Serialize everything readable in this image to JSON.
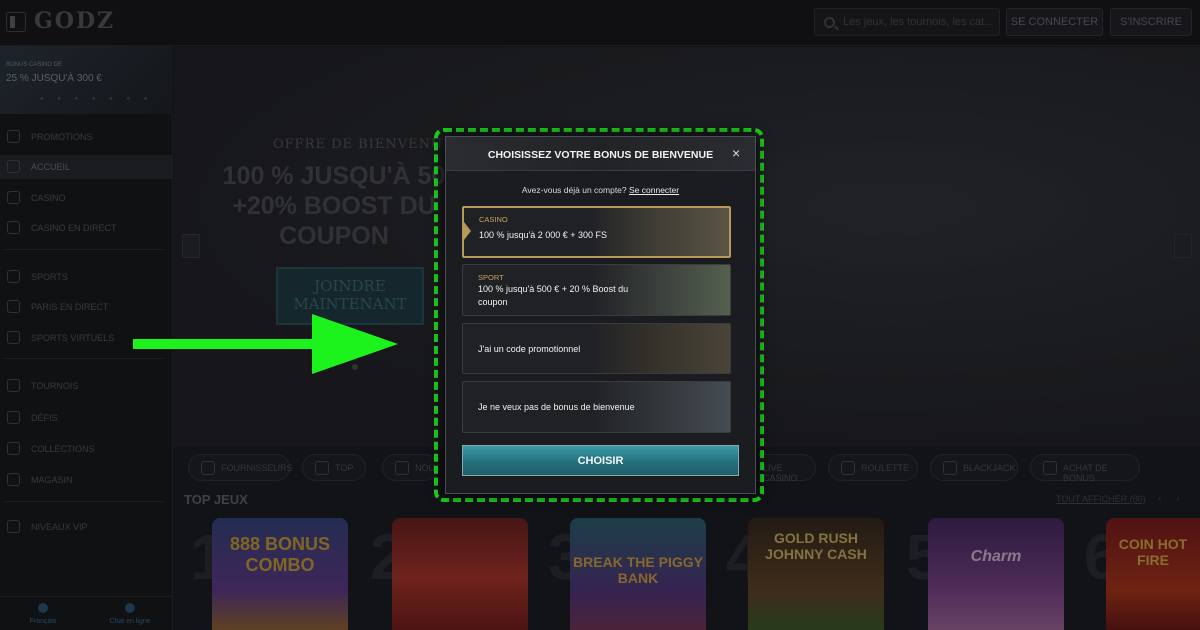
{
  "header": {
    "logo": "GODZ",
    "search_placeholder": "Les jeux, les tournois, les cat...",
    "login_label": "SE CONNECTER",
    "signup_label": "S'INSCRIRE"
  },
  "sidebar": {
    "promo": {
      "small": "BONUS CASINO DE",
      "big": "25 % JUSQU'À 300 €"
    },
    "items": [
      {
        "label": "PROMOTIONS",
        "icon": "gift-icon"
      },
      {
        "label": "ACCUEIL",
        "icon": "home-icon"
      },
      {
        "label": "CASINO",
        "icon": "slot-icon"
      },
      {
        "label": "CASINO EN DIRECT",
        "icon": "live-icon"
      },
      {
        "label": "SPORTS",
        "icon": "ball-icon"
      },
      {
        "label": "PARIS EN DIRECT",
        "icon": "live-bet-icon"
      },
      {
        "label": "SPORTS VIRTUELS",
        "icon": "virtual-icon"
      },
      {
        "label": "TOURNOIS",
        "icon": "trophy-icon"
      },
      {
        "label": "DÉFIS",
        "icon": "target-icon"
      },
      {
        "label": "COLLECTIONS",
        "icon": "collection-icon"
      },
      {
        "label": "MAGASIN",
        "icon": "shop-icon"
      },
      {
        "label": "NIVEAUX VIP",
        "icon": "vip-icon"
      }
    ],
    "bottom": {
      "left": "Français",
      "right": "Chat en ligne"
    }
  },
  "hero": {
    "kicker": "OFFRE DE BIENVENUE SPORT",
    "title": "100 % JUSQU'À 50 +20% BOOST DU COUPON",
    "cta": "JOINDRE MAINTENANT"
  },
  "chips": [
    "FOURNISSEURS",
    "TOP",
    "NOU",
    "LIVE CASINO",
    "ROULETTE",
    "BLACKJACK",
    "ACHAT DE BONUS"
  ],
  "top_games": {
    "title": "TOP JEUX",
    "view_all": "TOUT AFFICHER (80)",
    "arrows": "‹ ›",
    "ranks": [
      "1",
      "2",
      "3",
      "4",
      "5",
      "6"
    ],
    "cards": [
      "888 BONUS COMBO",
      "",
      "BREAK THE PIGGY BANK",
      "GOLD RUSH JOHNNY CASH",
      "Charm",
      "COIN HOT FIRE"
    ]
  },
  "modal": {
    "title": "CHOISISSEZ VOTRE BONUS DE BIENVENUE",
    "close": "×",
    "account_prompt": "Avez-vous déjà un compte?",
    "login_link": "Se connecter",
    "options": [
      {
        "category": "CASINO",
        "text": "100 % jusqu'à 2 000 € + 300 FS",
        "selected": true
      },
      {
        "category": "SPORT",
        "text": "100 % jusqu'à 500 € + 20 % Boost du coupon",
        "selected": false
      },
      {
        "category": "",
        "text": "J'ai un code promotionnel",
        "selected": false
      },
      {
        "category": "",
        "text": "Je ne veux pas de bonus de bienvenue",
        "selected": false
      }
    ],
    "choose_label": "CHOISIR"
  },
  "colors": {
    "highlight_green": "#1ed41e",
    "arrow_green": "#1cf21c",
    "selected_gold": "#b79a5a",
    "button_teal": "#2a8694"
  }
}
